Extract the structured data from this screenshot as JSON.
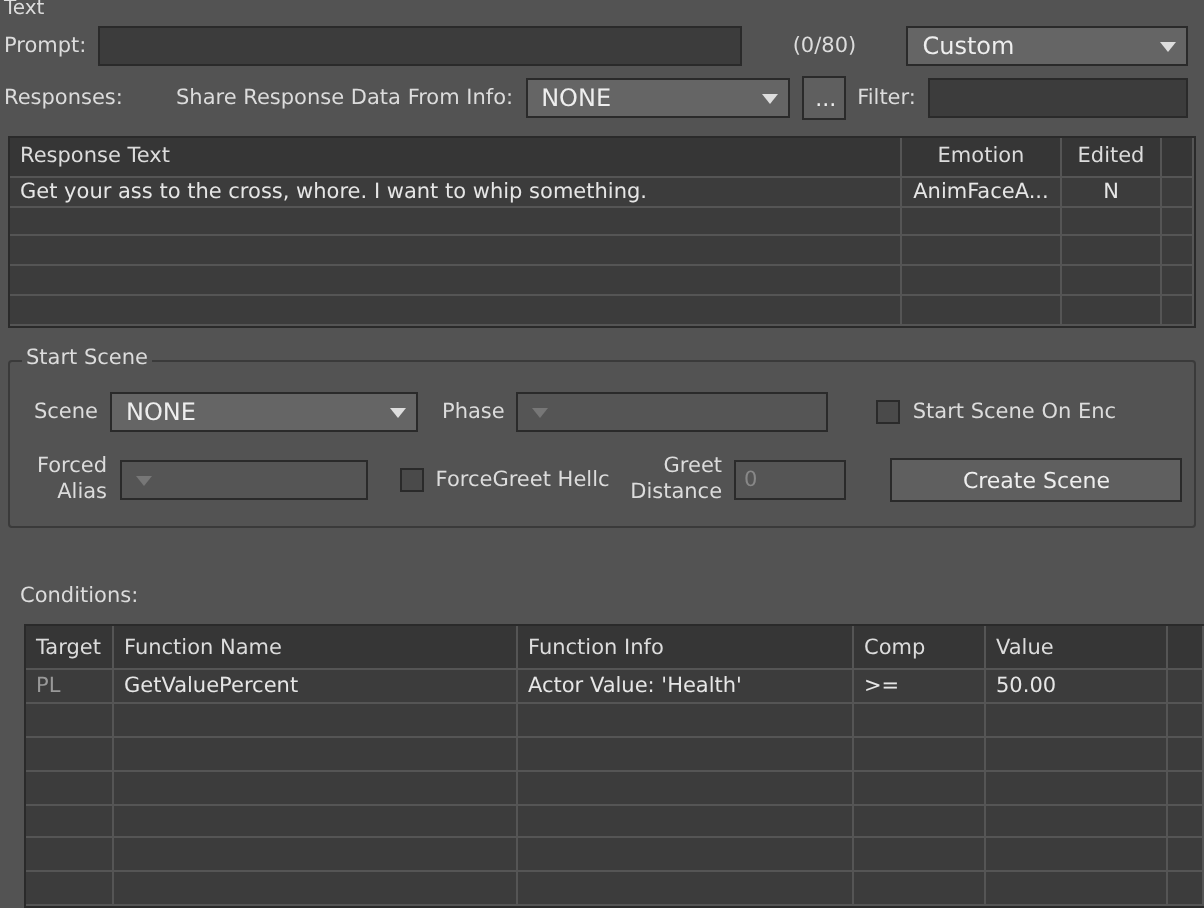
{
  "text_label": "Text",
  "prompt": {
    "label": "Prompt:",
    "counter": "(0/80)",
    "type_value": "Custom"
  },
  "responses": {
    "label": "Responses:",
    "share_label": "Share Response Data From Info:",
    "share_value": "NONE",
    "browse_button": "...",
    "filter_label": "Filter:"
  },
  "response_table": {
    "columns": [
      "Response Text",
      "Emotion",
      "Edited"
    ],
    "rows": [
      {
        "cells": [
          "Get your ass to the cross, whore. I want to whip something.",
          "AnimFaceA...",
          "N"
        ],
        "selected": false
      }
    ]
  },
  "start_scene": {
    "title": "Start Scene",
    "scene_label": "Scene",
    "scene_value": "NONE",
    "phase_label": "Phase",
    "start_on_end": {
      "label": "Start Scene On Enc",
      "checked": false
    },
    "forced_alias_label": "Forced Alias",
    "force_greet": {
      "label": "ForceGreet Hellc",
      "checked": false
    },
    "greet_distance_label": "Greet Distance",
    "greet_distance_placeholder": "0",
    "create_button": "Create Scene"
  },
  "conditions": {
    "label": "Conditions:",
    "columns": [
      "Target",
      "Function Name",
      "Function Info",
      "Comp",
      "Value"
    ],
    "rows": [
      {
        "cells": [
          "PL",
          "GetValuePercent",
          "Actor Value: 'Health'",
          ">=",
          "50.00"
        ]
      }
    ]
  }
}
